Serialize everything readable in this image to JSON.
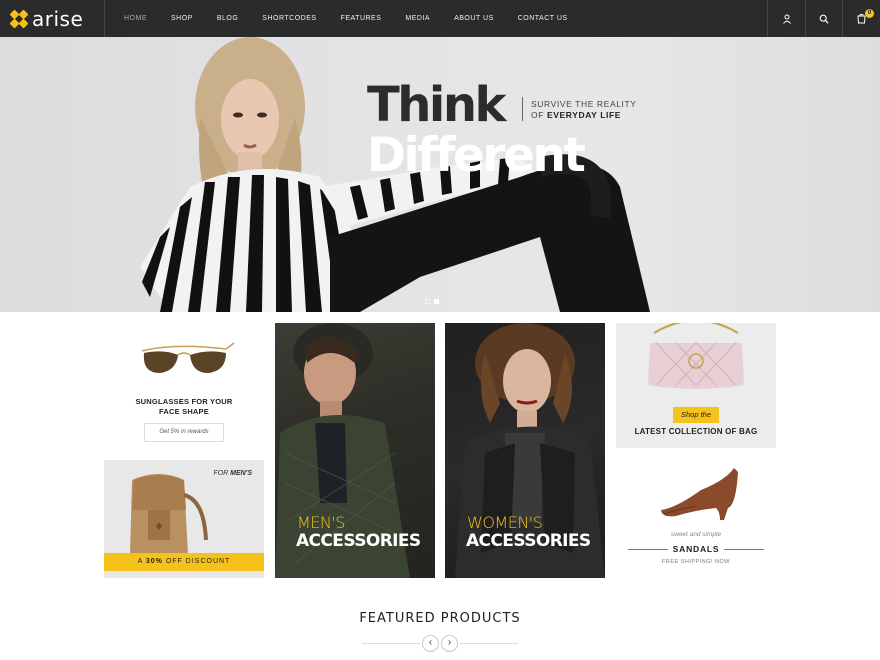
{
  "brand": {
    "name": "arise",
    "accent": "#f5c21b"
  },
  "nav": {
    "menu": [
      "HOME",
      "SHOP",
      "BLOG",
      "SHORTCODES",
      "FEATURES",
      "MEDIA",
      "ABOUT US",
      "CONTACT US"
    ],
    "active": "HOME",
    "icons": [
      "user-icon",
      "search-icon",
      "cart-icon"
    ],
    "cart_count": "0"
  },
  "hero": {
    "headline_1": "Think",
    "headline_2": "Different",
    "sub_1": "SURVIVE THE REALITY",
    "sub_2_prefix": "OF ",
    "sub_2_bold": "EVERYDAY LIFE",
    "slides": 2,
    "active_slide": 2
  },
  "promos": {
    "sunglasses": {
      "title_1": "SUNGLASSES FOR YOUR",
      "title_2": "FACE SHAPE",
      "button": "Get 5% in rewards"
    },
    "backpack": {
      "for_prefix": "FOR ",
      "for_bold": "MEN'S",
      "band_prefix": "A ",
      "band_bold": "30%",
      "band_suffix": " OFF DISCOUNT"
    },
    "men": {
      "line_1": "MEN'S",
      "line_2": "ACCESSORIES"
    },
    "women": {
      "line_1": "WOMEN'S",
      "line_2": "ACCESSORIES"
    },
    "bag": {
      "tag": "Shop the",
      "title": "LATEST COLLECTION OF BAG"
    },
    "shoe": {
      "script": "sweet and simple",
      "title": "SANDALS",
      "shipping": "FREE SHIPPING! NOW"
    }
  },
  "featured": {
    "title": "FEATURED PRODUCTS",
    "prev": "‹",
    "next": "›"
  }
}
